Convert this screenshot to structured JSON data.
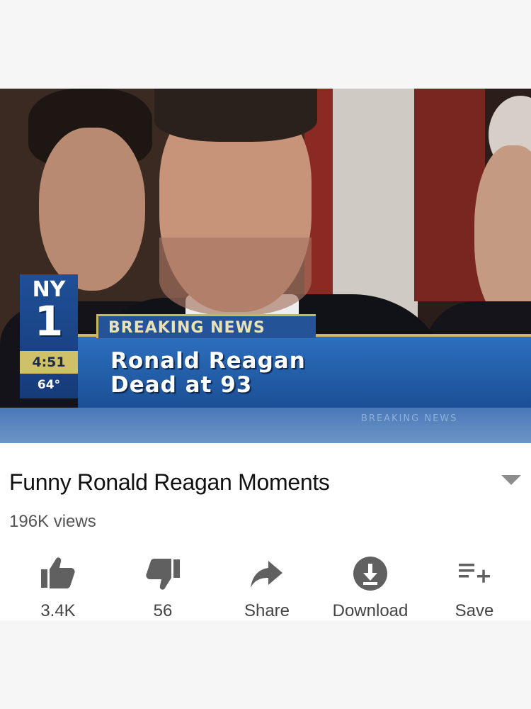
{
  "video": {
    "channel_logo_top": "NY",
    "channel_logo_number": "1",
    "clock": "4:51",
    "temperature": "64°",
    "breaking_label": "BREAKING NEWS",
    "headline_line1": "Ronald Reagan",
    "headline_line2": "Dead at 93",
    "ticker_text": "BREAKING NEWS"
  },
  "info": {
    "title": "Funny Ronald Reagan Moments",
    "views": "196K views",
    "expand_icon": "chevron-down-icon"
  },
  "actions": {
    "like_label": "3.4K",
    "dislike_label": "56",
    "share_label": "Share",
    "download_label": "Download",
    "save_label": "Save",
    "like_icon": "thumbs-up-icon",
    "dislike_icon": "thumbs-down-icon",
    "share_icon": "share-arrow-icon",
    "download_icon": "download-icon",
    "save_icon": "playlist-add-icon"
  },
  "colors": {
    "icon_gray": "#606060",
    "news_blue": "#255397",
    "news_gold": "#c8b860"
  }
}
